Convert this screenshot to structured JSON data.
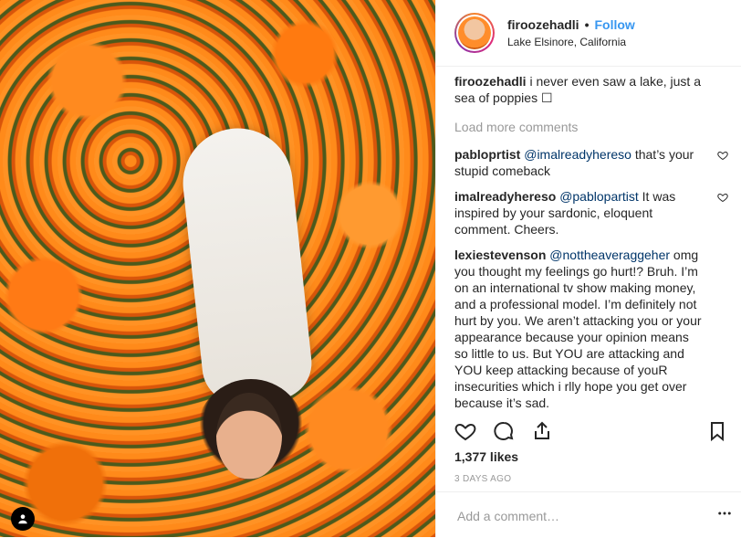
{
  "post": {
    "username": "firoozehadli",
    "separator": "•",
    "follow_label": "Follow",
    "location": "Lake Elsinore, California"
  },
  "caption": {
    "username": "firoozehadli",
    "text": "i never even saw a lake, just a sea of poppies ☐"
  },
  "load_more": "Load more comments",
  "comments": [
    {
      "username": "pabloprtist",
      "mention": "@imalreadyhereso",
      "text": "that’s your stupid comeback"
    },
    {
      "username": "imalreadyhereso",
      "mention": "@pablopartist",
      "text": "It was inspired by your sardonic, eloquent comment. Cheers."
    },
    {
      "username": "lexiestevenson",
      "mention": "@nottheaveraggeher",
      "text": "omg you thought my feelings go hurt!? Bruh. I’m on an international tv show making money, and a professional model. I’m definitely not hurt by you. We aren’t attacking you or your appearance because your opinion means so little to us. But YOU are attacking and YOU keep attacking because of youR insecurities which i rlly hope you get over because it’s sad."
    }
  ],
  "likes": "1,377 likes",
  "time_ago": "3 DAYS AGO",
  "add_comment_placeholder": "Add a comment…",
  "icons": {
    "like": "heart-icon",
    "comment": "comment-icon",
    "share": "share-icon",
    "save": "bookmark-icon",
    "more": "more-options-icon",
    "profile": "user-profile-icon"
  },
  "colors": {
    "accent": "#3897f0",
    "text": "#262626",
    "muted": "#999999"
  }
}
